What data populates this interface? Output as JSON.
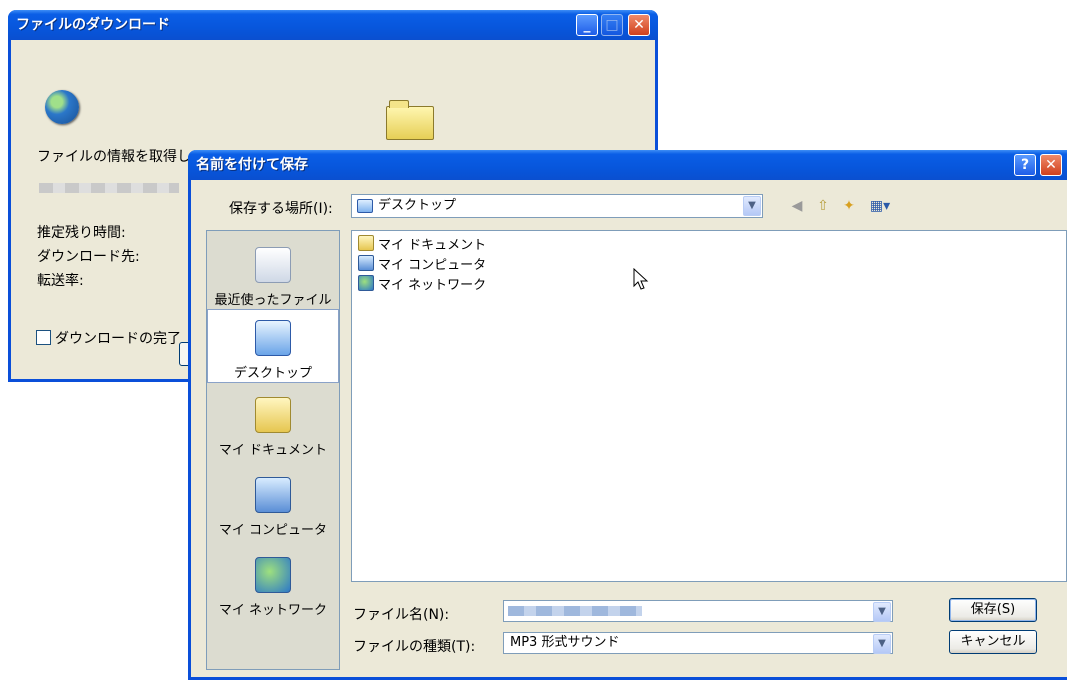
{
  "download_dialog": {
    "title": "ファイルのダウンロード",
    "status": "ファイルの情報を取得し",
    "estimated_time_label": "推定残り時間:",
    "download_to_label": "ダウンロード先:",
    "transfer_rate_label": "転送率:",
    "close_on_complete_label": "ダウンロードの完了"
  },
  "save_dialog": {
    "title": "名前を付けて保存",
    "help_button": "?",
    "save_in_label": "保存する場所(I):",
    "save_in_value": "デスクトップ",
    "places": [
      {
        "label": "最近使ったファイル",
        "icon": "recent-files-icon"
      },
      {
        "label": "デスクトップ",
        "icon": "desktop-icon",
        "selected": true
      },
      {
        "label": "マイ ドキュメント",
        "icon": "my-documents-icon"
      },
      {
        "label": "マイ コンピュータ",
        "icon": "my-computer-icon"
      },
      {
        "label": "マイ ネットワーク",
        "icon": "my-network-icon"
      }
    ],
    "files": [
      {
        "name": "マイ ドキュメント",
        "icon": "my-documents-icon"
      },
      {
        "name": "マイ コンピュータ",
        "icon": "my-computer-icon"
      },
      {
        "name": "マイ ネットワーク",
        "icon": "my-network-icon"
      }
    ],
    "filename_label": "ファイル名(N):",
    "filename_value": "",
    "filetype_label": "ファイルの種類(T):",
    "filetype_value": "MP3 形式サウンド",
    "save_button": "保存(S)",
    "cancel_button": "キャンセル"
  },
  "colors": {
    "titlebar": "#0a5ee6",
    "dialog_bg": "#ece9d8",
    "places_bg": "#dcdcd0",
    "border": "#7f9db9"
  }
}
